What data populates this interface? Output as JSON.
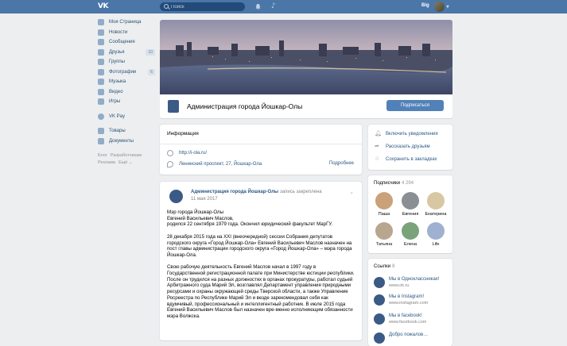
{
  "topbar": {
    "logo": "VK",
    "search_placeholder": "Поиск",
    "username": "Big"
  },
  "sidebar": {
    "items": [
      {
        "label": "Моя Страница",
        "icon": "home-icon"
      },
      {
        "label": "Новости",
        "icon": "news-icon"
      },
      {
        "label": "Сообщения",
        "icon": "messages-icon"
      },
      {
        "label": "Друзья",
        "icon": "friends-icon",
        "count": "10"
      },
      {
        "label": "Группы",
        "icon": "groups-icon"
      },
      {
        "label": "Фотографии",
        "icon": "photos-icon",
        "count": "6"
      },
      {
        "label": "Музыка",
        "icon": "music-icon"
      },
      {
        "label": "Видео",
        "icon": "video-icon"
      },
      {
        "label": "Игры",
        "icon": "games-icon"
      },
      {
        "label": "VK Pay",
        "icon": "vkpay-icon"
      },
      {
        "label": "Товары",
        "icon": "goods-icon"
      },
      {
        "label": "Документы",
        "icon": "docs-icon"
      }
    ],
    "footer": {
      "blog": "Блог",
      "devs": "Разработчикам",
      "ads": "Реклама",
      "more": "Ещё ⌄"
    }
  },
  "group": {
    "name": "Администрация города Йошкар-Олы",
    "subscribe": "Подписаться"
  },
  "info": {
    "title": "Информация",
    "site": "http://i-ola.ru/",
    "address": "Ленинский проспект, 27, Йошкар-Ола",
    "more": "Подробнее"
  },
  "post": {
    "author": "Администрация города Йошкар-Олы",
    "pinned": "запись закреплена",
    "date": "11 мая 2017",
    "p1": "Мэр города Йошкар-Олы\nЕвгений Васильевич Маслов,\nродился 22 сентября 1979 года. Окончил юридический факультет МарГУ.",
    "p2": "28 декабря 2015 года на XXI (внеочередной) сессии Собрания депутатов городского округа «Город Йошкар-Ола» Евгений Васильевич Маслов назначен на пост главы администрации городского округа «Город Йошкар-Ола» – мэра города Йошкар-Ола.",
    "p3": "Свою рабочую деятельность Евгений Маслов начал в 1997 году в Государственной регистрационной палате при Министерстве юстиции республики. После он трудился на разных должностях в органах прокуратуры, работал судьей Арбитражного суда Марий Эл, возглавлял Департамент управления природными ресурсами и охраны окружающей среды Тверской области, а также Управление Росреестра по Республике Марий Эл и везде зарекомендовал себя как вдумчивый, профессиональный и интеллигентный работник. В июле 2015 года Евгений Васильевич Маслов был назначен вре-менно исполняющим обязанности мэра Волжска."
  },
  "actions": {
    "notify": "Включить уведомления",
    "tell": "Рассказать друзьям",
    "save": "Сохранить в закладках"
  },
  "subscribers": {
    "title": "Подписчики",
    "count": "4 294",
    "people": [
      {
        "name": "Паша",
        "color": "#c9a27a"
      },
      {
        "name": "Евгения",
        "color": "#8a8f93"
      },
      {
        "name": "Екатерина",
        "color": "#d8c7a3"
      },
      {
        "name": "Татьяна",
        "color": "#b8a68e"
      },
      {
        "name": "Елена",
        "color": "#7aa37a"
      },
      {
        "name": "Life",
        "color": "#9fb0d0"
      }
    ]
  },
  "links": {
    "title": "Ссылки",
    "count": "8",
    "items": [
      {
        "name": "Мы в Одноклассниках!",
        "url": "www.ok.ru"
      },
      {
        "name": "Мы в Instagram!",
        "url": "www.instagram.com"
      },
      {
        "name": "Мы в facebook!",
        "url": "www.facebook.com"
      },
      {
        "name": "Добро пожалов…",
        "url": ""
      }
    ]
  }
}
